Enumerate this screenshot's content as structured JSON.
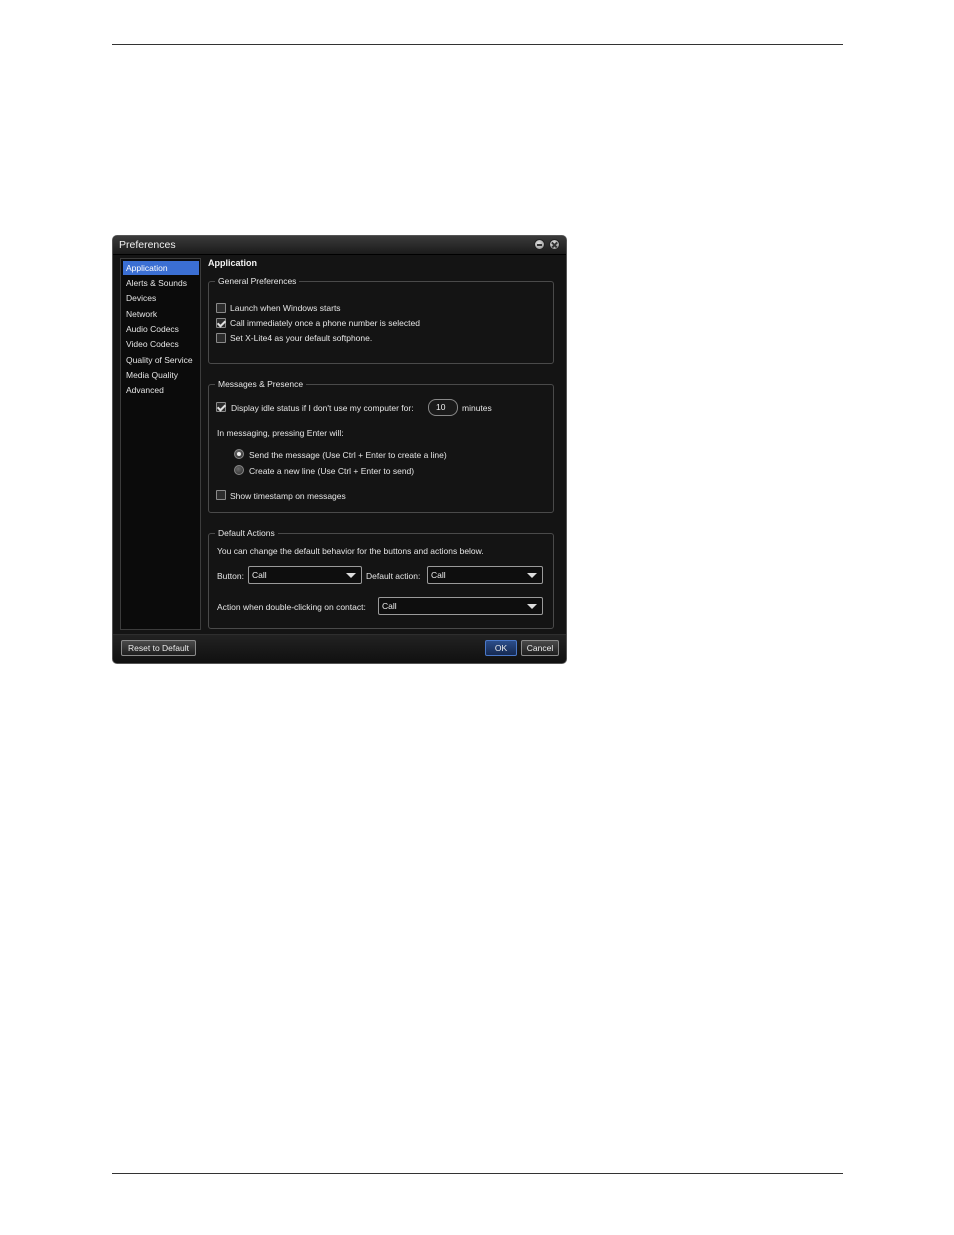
{
  "window": {
    "title": "Preferences",
    "section_title": "Application"
  },
  "sidebar": {
    "items": [
      {
        "label": "Application",
        "active": true
      },
      {
        "label": "Alerts & Sounds"
      },
      {
        "label": "Devices"
      },
      {
        "label": "Network"
      },
      {
        "label": "Audio Codecs"
      },
      {
        "label": "Video Codecs"
      },
      {
        "label": "Quality of Service"
      },
      {
        "label": "Media Quality"
      },
      {
        "label": "Advanced"
      }
    ]
  },
  "general": {
    "legend": "General Preferences",
    "launch_label": "Launch when Windows starts",
    "launch_checked": false,
    "call_label": "Call immediately once a phone number is selected",
    "call_checked": true,
    "default_label": "Set X-Lite4 as your default softphone.",
    "default_checked": false
  },
  "messages": {
    "legend": "Messages & Presence",
    "idle_label": "Display idle status if I don't use my computer for:",
    "idle_checked": true,
    "idle_value": "10",
    "idle_unit": "minutes",
    "enter_intro": "In messaging, pressing Enter will:",
    "radio_send": "Send the message (Use Ctrl + Enter to create a line)",
    "radio_newline": "Create a new line (Use Ctrl + Enter to send)",
    "selected_radio": "send",
    "timestamp_label": "Show timestamp on messages",
    "timestamp_checked": false
  },
  "default_actions": {
    "legend": "Default Actions",
    "description": "You can change the default behavior for the buttons and actions below.",
    "button_label": "Button:",
    "button_value": "Call",
    "default_action_label": "Default action:",
    "default_action_value": "Call",
    "dblclick_label": "Action when double-clicking on contact:",
    "dblclick_value": "Call"
  },
  "footer": {
    "reset_label": "Reset to Default",
    "ok_label": "OK",
    "cancel_label": "Cancel"
  },
  "colors": {
    "accent": "#3b6fd3",
    "window_bg": "#141414"
  }
}
